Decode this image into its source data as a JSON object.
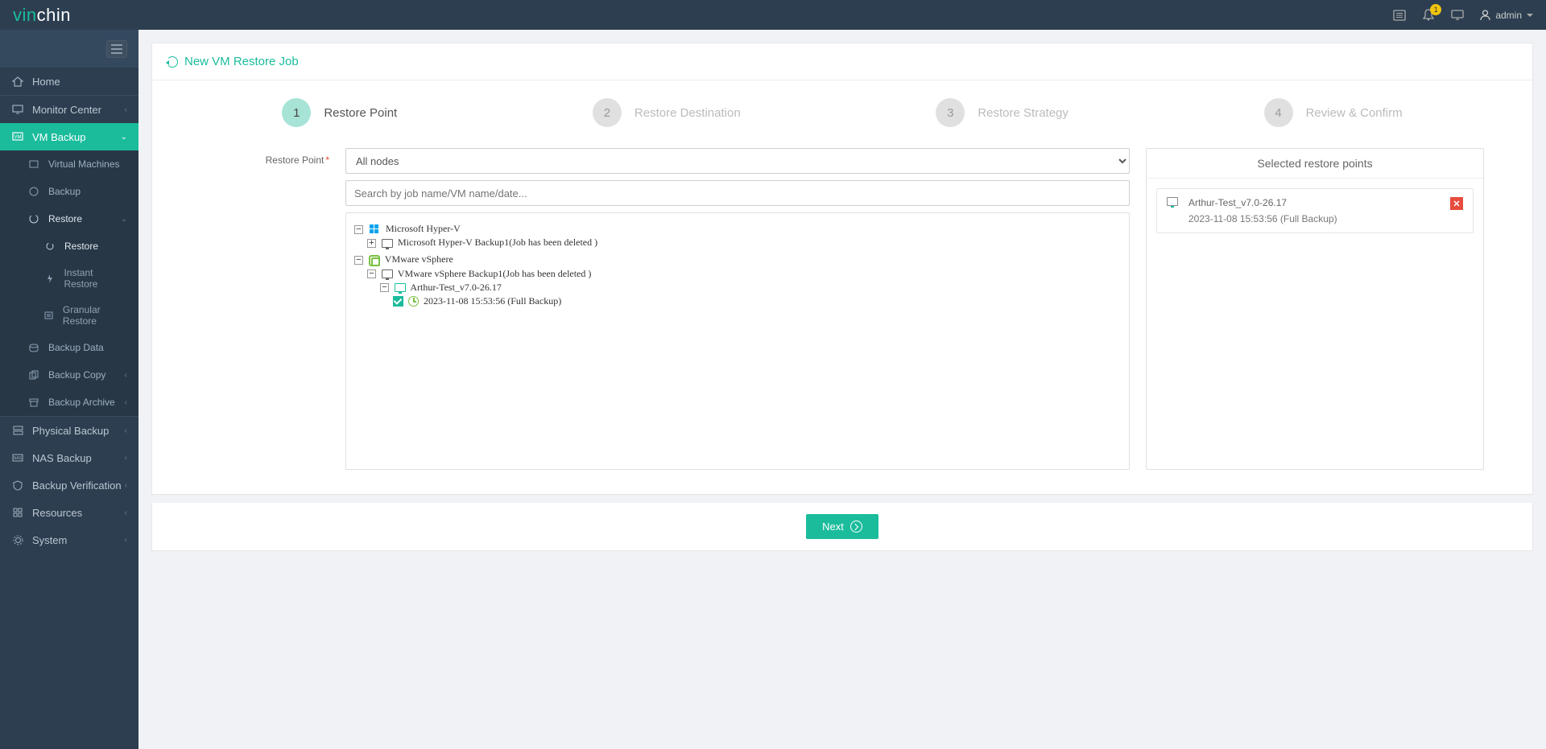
{
  "topbar": {
    "logo_prefix": "vin",
    "logo_suffix": "chin",
    "notif_count": "1",
    "user": "admin"
  },
  "sidebar": {
    "home": "Home",
    "monitor": "Monitor Center",
    "vmbackup": "VM Backup",
    "virtual_machines": "Virtual Machines",
    "backup": "Backup",
    "restore": "Restore",
    "restore_sub": "Restore",
    "instant_restore": "Instant Restore",
    "granular_restore": "Granular Restore",
    "backup_data": "Backup Data",
    "backup_copy": "Backup Copy",
    "backup_archive": "Backup Archive",
    "physical_backup": "Physical Backup",
    "nas_backup": "NAS Backup",
    "backup_verification": "Backup Verification",
    "resources": "Resources",
    "system": "System"
  },
  "panel": {
    "title": "New VM Restore Job"
  },
  "steps": {
    "s1": "Restore Point",
    "s2": "Restore Destination",
    "s3": "Restore Strategy",
    "s4": "Review & Confirm"
  },
  "form": {
    "label": "Restore Point",
    "node_select": "All nodes",
    "search_placeholder": "Search by job name/VM name/date..."
  },
  "tree": {
    "hyperv": "Microsoft Hyper-V",
    "hyperv_job": "Microsoft Hyper-V Backup1(Job has been deleted )",
    "vmware": "VMware vSphere",
    "vmware_job": "VMware vSphere Backup1(Job has been deleted )",
    "vm_name": "Arthur-Test_v7.0-26.17",
    "restore_point": "2023-11-08 15:53:56 (Full  Backup)"
  },
  "selected": {
    "title": "Selected restore points",
    "vm": "Arthur-Test_v7.0-26.17",
    "point": "2023-11-08 15:53:56 (Full Backup)"
  },
  "footer": {
    "next": "Next"
  }
}
